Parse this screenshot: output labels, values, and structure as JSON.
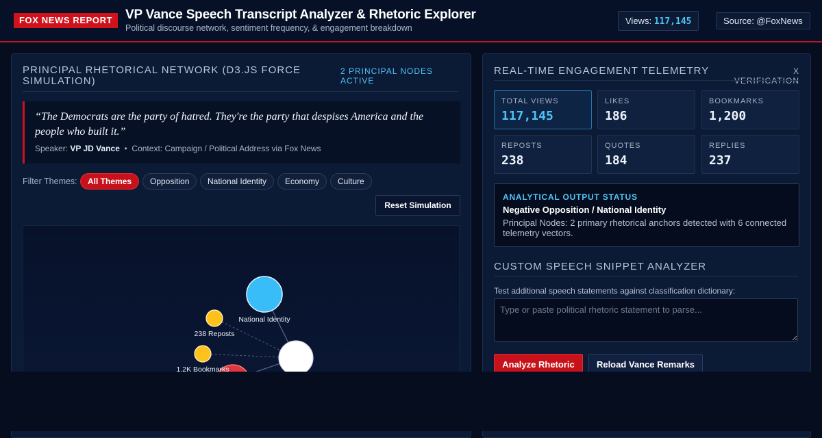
{
  "header": {
    "badge": "FOX NEWS REPORT",
    "title": "VP Vance Speech Transcript Analyzer & Rhetoric Explorer",
    "subtitle": "Political discourse network, sentiment frequency, & engagement breakdown",
    "views_label": "Views:",
    "views_value": "117,145",
    "source": "Source: @FoxNews"
  },
  "left": {
    "title": "Principal Rhetorical Network (D3.js Force Simulation)",
    "meta": "2 Principal Nodes Active",
    "quote": "“The Democrats are the party of hatred. They're the party that despises America and the people who built it.”",
    "speaker_label": "Speaker:",
    "speaker": "VP JD Vance",
    "separator": "•",
    "context": "Context: Campaign / Political Address via Fox News",
    "filter_label": "Filter Themes:",
    "filters": [
      "All Themes",
      "Opposition",
      "National Identity",
      "Economy",
      "Culture"
    ],
    "reset_label": "Reset Simulation",
    "graph_labels": {
      "national_identity": "National Identity",
      "reposts": "238 Reposts",
      "bookmarks": "1.2K Bookmarks"
    }
  },
  "right": {
    "title": "Real-Time Engagement Telemetry",
    "meta": "X Verification",
    "stats": [
      {
        "label": "Total Views",
        "value": "117,145"
      },
      {
        "label": "Likes",
        "value": "186"
      },
      {
        "label": "Bookmarks",
        "value": "1,200"
      },
      {
        "label": "Reposts",
        "value": "238"
      },
      {
        "label": "Quotes",
        "value": "184"
      },
      {
        "label": "Replies",
        "value": "237"
      }
    ],
    "status": {
      "head": "Analytical Output Status",
      "main": "Negative Opposition / National Identity",
      "desc": "Principal Nodes: 2 primary rhetorical anchors detected with 6 connected telemetry vectors."
    },
    "analyzer_title": "Custom Speech Snippet Analyzer",
    "analyzer_label": "Test additional speech statements against classification dictionary:",
    "placeholder": "Type or paste political rhetoric statement to parse...",
    "analyze_label": "Analyze Rhetoric",
    "reload_label": "Reload Vance Remarks"
  },
  "colors": {
    "accent_red": "#c8121b",
    "accent_blue": "#4fc3f7",
    "node_yellow": "#ffc21a"
  }
}
